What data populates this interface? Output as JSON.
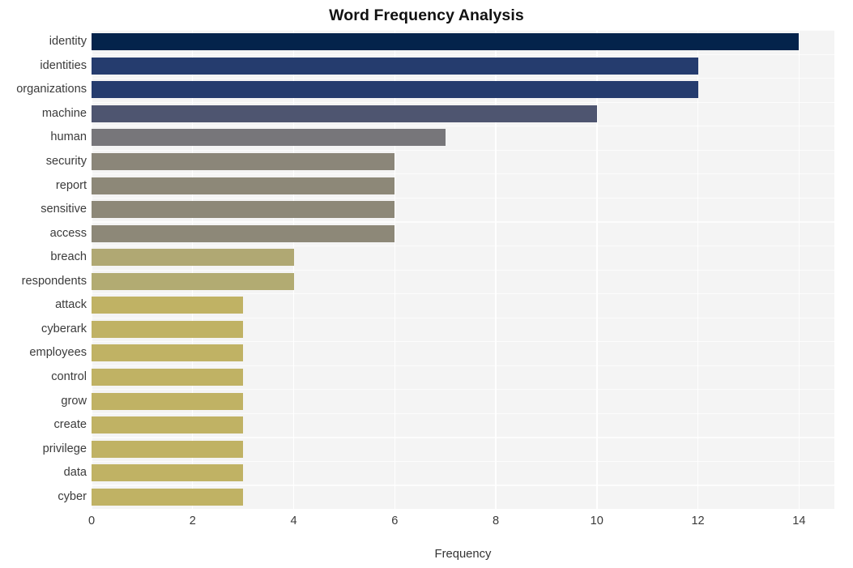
{
  "chart_data": {
    "type": "bar",
    "orientation": "horizontal",
    "title": "Word Frequency Analysis",
    "xlabel": "Frequency",
    "ylabel": "",
    "xlim": [
      0,
      14.7
    ],
    "ylim_count": 20,
    "grid": true,
    "legend": null,
    "style": "whitegrid",
    "xticks": [
      "0",
      "2",
      "4",
      "6",
      "8",
      "10",
      "12",
      "14"
    ],
    "xtick_values": [
      0,
      2,
      4,
      6,
      8,
      10,
      12,
      14
    ],
    "categories": [
      "identity",
      "identities",
      "organizations",
      "machine",
      "human",
      "security",
      "report",
      "sensitive",
      "access",
      "breach",
      "respondents",
      "attack",
      "cyberark",
      "employees",
      "control",
      "grow",
      "create",
      "privilege",
      "data",
      "cyber"
    ],
    "values": [
      14,
      12,
      12,
      10,
      7,
      6,
      6,
      6,
      6,
      4,
      4,
      3,
      3,
      3,
      3,
      3,
      3,
      3,
      3,
      3
    ],
    "bar_colors": [
      "#04234b",
      "#253c6e",
      "#253c6e",
      "#4e5570",
      "#77767a",
      "#8b8679",
      "#8d8878",
      "#8d8878",
      "#8d8878",
      "#b0a873",
      "#b2ab72",
      "#c0b264",
      "#c0b264",
      "#c0b264",
      "#c0b264",
      "#c0b264",
      "#c0b264",
      "#c0b264",
      "#c0b264",
      "#c0b264"
    ]
  },
  "colors": {
    "plot_background": "#f4f4f4",
    "figure_background": "#ffffff",
    "gridline": "#ffffff",
    "tick_label": "#3b3b3b",
    "axis_label": "#333333",
    "title": "#111111"
  }
}
